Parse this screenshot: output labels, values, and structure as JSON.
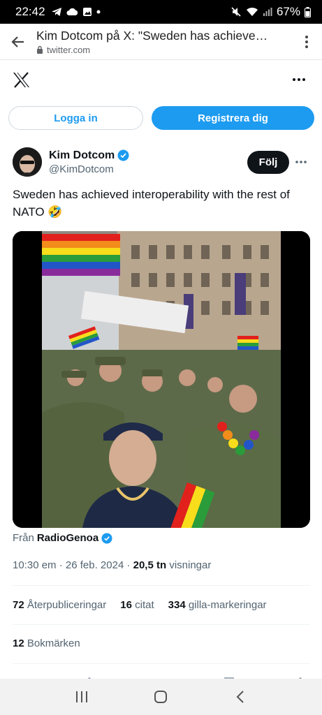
{
  "status_bar": {
    "time": "22:42",
    "battery": "67%"
  },
  "browser": {
    "page_title": "Kim Dotcom på X: \"Sweden has achieve…",
    "url": "twitter.com"
  },
  "auth": {
    "login": "Logga in",
    "signup": "Registrera dig"
  },
  "tweet": {
    "author_name": "Kim Dotcom",
    "handle": "@KimDotcom",
    "follow_label": "Följ",
    "text": "Sweden has achieved interoperability with the rest of NATO 🤣",
    "from_prefix": "Från",
    "from_source": "RadioGenoa",
    "time": "10:30 em · 26 feb. 2024 · ",
    "views_count": "20,5 tn",
    "views_label": " visningar",
    "reposts_count": "72",
    "reposts_label": "Återpubliceringar",
    "quotes_count": "16",
    "quotes_label": "citat",
    "likes_count": "334",
    "likes_label": "gilla-markeringar",
    "bookmarks_count": "12",
    "bookmarks_label": "Bokmärken"
  },
  "colors": {
    "accent": "#1d9bf0",
    "text": "#0f1419",
    "muted": "#536471"
  },
  "icons": [
    "back-arrow-icon",
    "lock-icon",
    "overflow-menu-icon",
    "x-logo-icon",
    "verified-badge-icon",
    "more-icon",
    "recent-apps-icon",
    "home-icon",
    "back-icon"
  ]
}
